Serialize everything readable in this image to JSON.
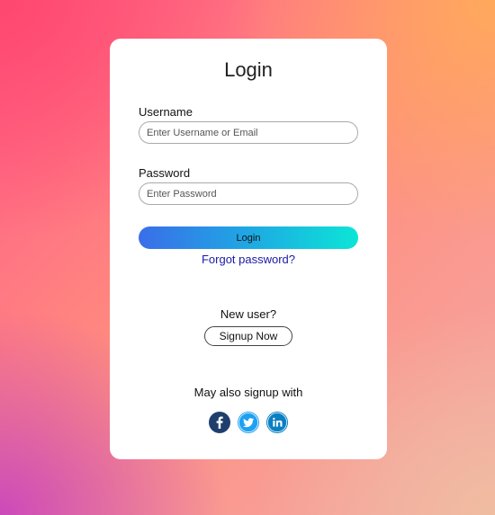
{
  "login_form": {
    "title": "Login",
    "username_label": "Username",
    "username_placeholder": "Enter Username or Email",
    "username_value": "",
    "password_label": "Password",
    "password_placeholder": "Enter Password",
    "password_value": "",
    "login_button_label": "Login",
    "forgot_password_link": "Forgot password?"
  },
  "signup": {
    "new_user_text": "New user?",
    "signup_button_label": "Signup Now",
    "social_text": "May also signup with",
    "social_icons": [
      "facebook-icon",
      "twitter-icon",
      "linkedin-icon"
    ]
  },
  "colors": {
    "facebook": "#1e3f6e",
    "twitter": "#1da1f2",
    "linkedin": "#0a80c2",
    "link": "#1a1aa6",
    "login_gradient_start": "#3a6ee8",
    "login_gradient_end": "#0ce5d6"
  }
}
